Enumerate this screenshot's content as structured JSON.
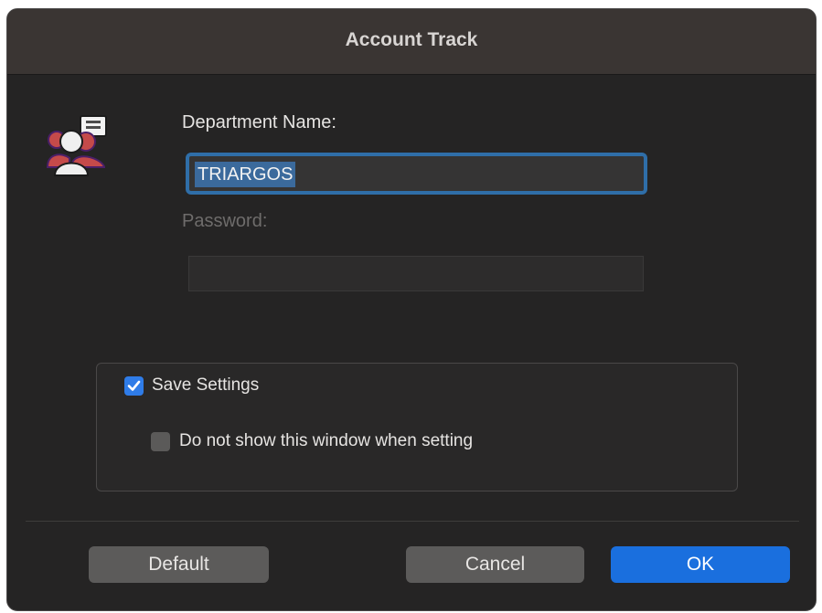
{
  "window": {
    "title": "Account Track"
  },
  "form": {
    "department_label": "Department Name:",
    "department_value": "TRIARGOS",
    "password_label": "Password:",
    "password_value": ""
  },
  "settings": {
    "save_settings_label": "Save Settings",
    "save_settings_checked": true,
    "do_not_show_label": "Do not show this window when setting",
    "do_not_show_checked": false
  },
  "buttons": {
    "default_label": "Default",
    "cancel_label": "Cancel",
    "ok_label": "OK"
  },
  "icons": {
    "account_icon": "account-track-icon",
    "checkmark_icon": "checkmark-icon"
  },
  "colors": {
    "accent": "#1a6fde",
    "checkbox_checked": "#2f7ce8",
    "focus_ring": "#2f6ea8",
    "window_bg": "#252424",
    "titlebar_bg": "#3a3533"
  }
}
